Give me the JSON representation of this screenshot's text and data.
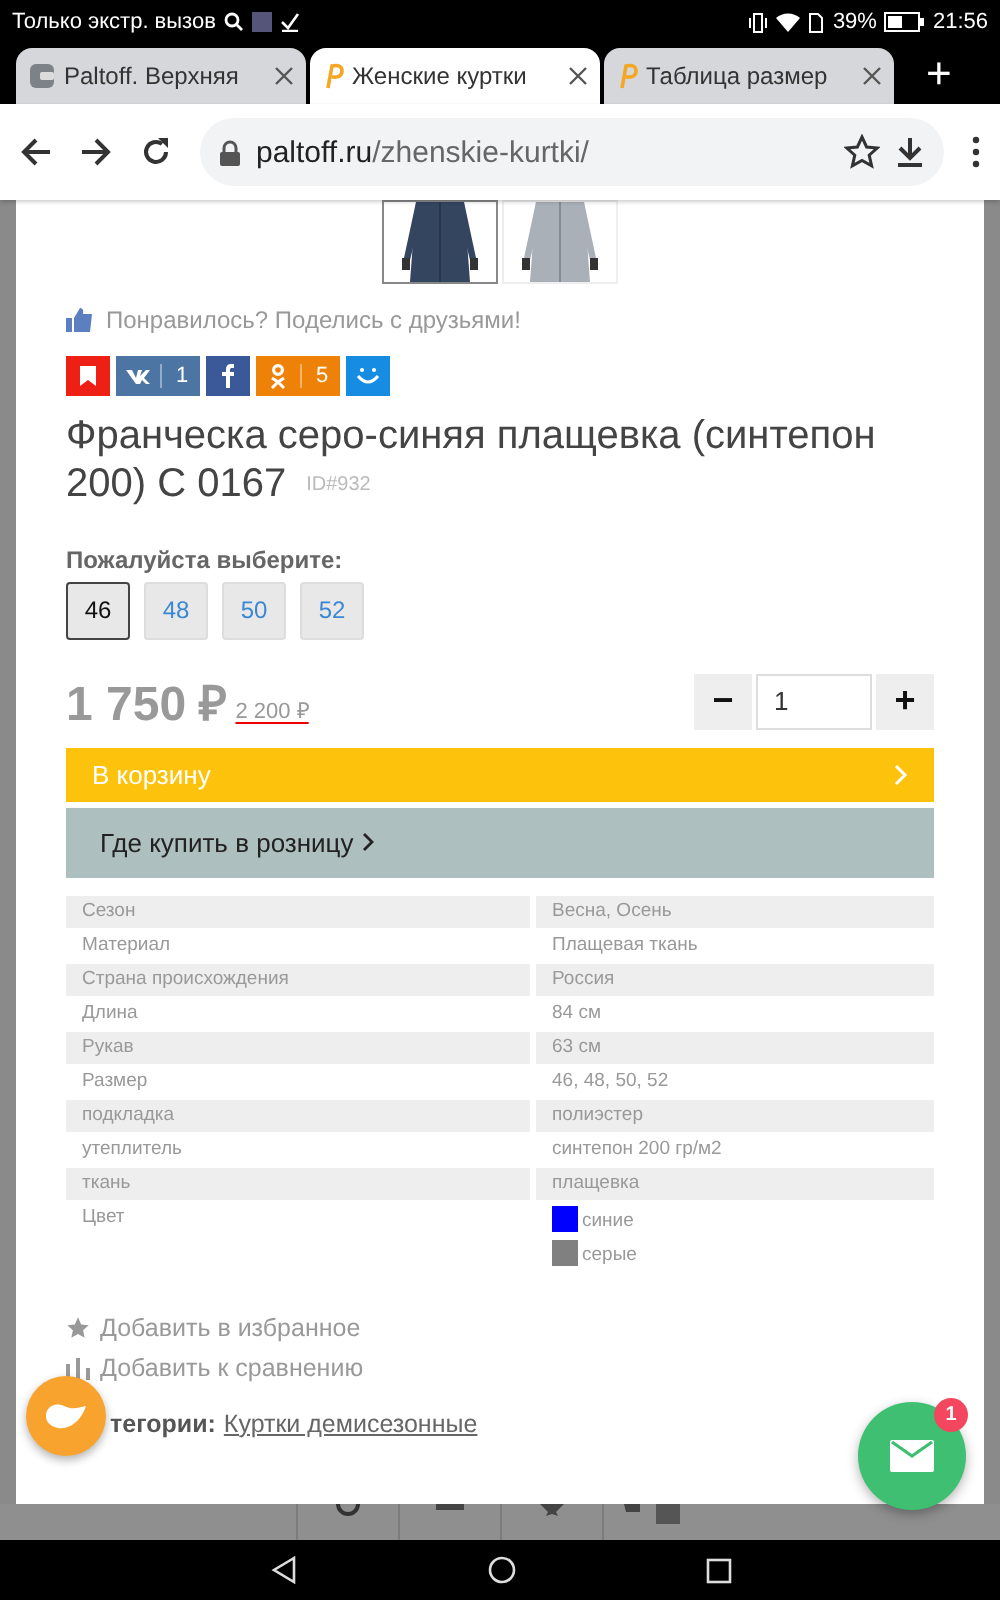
{
  "status_bar": {
    "carrier": "Только экстр. вызов",
    "battery": "39%",
    "time": "21:56"
  },
  "tabs": [
    {
      "title": "Paltoff. Верхняя",
      "kind": "wallet",
      "selected": false
    },
    {
      "title": "Женские куртки",
      "kind": "p",
      "selected": true
    },
    {
      "title": "Таблица размер",
      "kind": "p",
      "selected": false
    }
  ],
  "new_tab": "+",
  "address_bar": {
    "host": "paltoff.ru",
    "path": "/zhenskie-kurtki/"
  },
  "product": {
    "thumbnails": [
      {
        "kind": "picture",
        "selected": true
      },
      {
        "kind": "picture",
        "selected": false
      }
    ],
    "share_prompt": "Понравилось? Поделись с друзьями!",
    "share_buttons": [
      {
        "kind": "bookmark",
        "color": "#ee1f14"
      },
      {
        "kind": "vk",
        "color": "#4c75a3",
        "count": "1"
      },
      {
        "kind": "facebook",
        "color": "#3b5998"
      },
      {
        "kind": "ok",
        "color": "#ee8208",
        "count": "5"
      },
      {
        "kind": "mymail",
        "color": "#168de2"
      }
    ],
    "title": "Франческа серо-синяя плащевка (синтепон 200) С 0167",
    "id": "ID#932",
    "size_prompt": "Пожалуйста выберите:",
    "sizes": [
      {
        "label": "46",
        "selected": true
      },
      {
        "label": "48",
        "selected": false
      },
      {
        "label": "50",
        "selected": false
      },
      {
        "label": "52",
        "selected": false
      }
    ],
    "price": "1 750 ₽",
    "old_price": "2 200 ₽",
    "quantity": {
      "minus": "−",
      "value": "1",
      "plus": "+"
    },
    "cart_button": "В корзину",
    "retail_button": "Где купить в розницу",
    "specs": [
      {
        "name": "Сезон",
        "value": "Весна, Осень"
      },
      {
        "name": "Материал",
        "value": "Плащевая ткань"
      },
      {
        "name": "Страна происхождения",
        "value": "Россия"
      },
      {
        "name": "Длина",
        "value": "84 см"
      },
      {
        "name": "Рукав",
        "value": "63 см"
      },
      {
        "name": "Размер",
        "value": "46, 48, 50, 52"
      },
      {
        "name": "подкладка",
        "value": "полиэстер"
      },
      {
        "name": "утеплитель",
        "value": "синтепон 200 гр/м2"
      },
      {
        "name": "ткань",
        "value": "плащевка"
      }
    ],
    "colors": {
      "name": "Цвет",
      "items": [
        {
          "label": "синие",
          "color": "#0000ff"
        },
        {
          "label": "серые",
          "color": "#808080"
        }
      ]
    },
    "favorites": "Добавить в избранное",
    "compare": "Добавить к сравнению",
    "category_label": "тегории:",
    "category_link": "Куртки демисезонные"
  },
  "chat": {
    "badge": "1"
  }
}
